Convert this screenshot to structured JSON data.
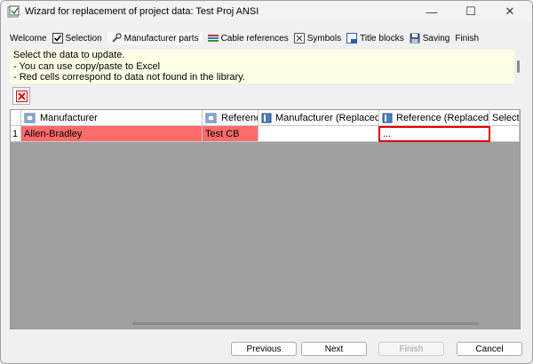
{
  "window": {
    "title": "Wizard for replacement of project data: Test Proj ANSI"
  },
  "titlebar_buttons": {
    "minimize": "—",
    "maximize": "☐",
    "close": "✕"
  },
  "tabs": [
    {
      "label": "Welcome",
      "icon": "none"
    },
    {
      "label": "Selection",
      "icon": "checkbox-icon"
    },
    {
      "label": "Manufacturer parts",
      "icon": "wrench-icon",
      "active": true
    },
    {
      "label": "Cable references",
      "icon": "cable-icon"
    },
    {
      "label": "Symbols",
      "icon": "symbols-icon"
    },
    {
      "label": "Title blocks",
      "icon": "title-block-icon"
    },
    {
      "label": "Saving",
      "icon": "save-icon"
    },
    {
      "label": "Finish",
      "icon": "none"
    }
  ],
  "info": {
    "line1": "Select the data to update.",
    "line2": "- You can use copy/paste to Excel",
    "line3": "- Red cells correspond to data not found in the library."
  },
  "grid": {
    "columns": [
      "Manufacturer",
      "Reference",
      "Manufacturer (Replaced by)",
      "Reference (Replaced by)",
      "Select"
    ],
    "rows": [
      {
        "num": "1",
        "manufacturer": "Allen-Bradley",
        "reference": "Test CB",
        "manufacturer_replaced": "",
        "reference_replaced": "...",
        "select": ""
      }
    ]
  },
  "buttons": {
    "previous": "Previous",
    "next": "Next",
    "finish": "Finish",
    "cancel": "Cancel"
  },
  "colors": {
    "missing_cell": "#ff6b6b",
    "focus_border": "#e00000",
    "info_bg": "#ffffe6",
    "grid_bg": "#a0a0a0"
  }
}
